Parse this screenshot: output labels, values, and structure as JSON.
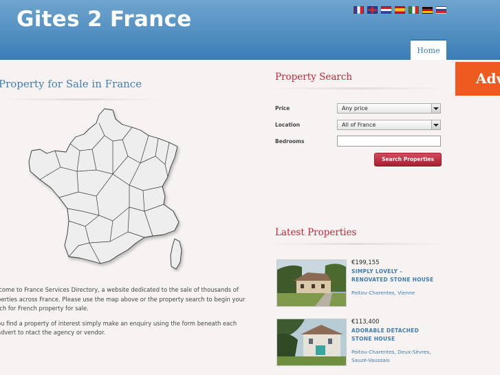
{
  "header": {
    "logo": "Gites 2 France",
    "flags": [
      "fr",
      "gb",
      "nl",
      "es",
      "it",
      "de",
      "ru"
    ],
    "nav_home": "Home"
  },
  "advert_tab": "Adv",
  "main": {
    "title": "Property for Sale in France",
    "intro": [
      "lcome to France Services Directory, a website dedicated to the sale of thousands of perties across France. Please use the map above or the property search to begin your rch for French property for sale.",
      "ou find a property of interest simply make an enquiry using the form beneath each advert to ntact the agency or vendor."
    ]
  },
  "search": {
    "title": "Property Search",
    "price_label": "Price",
    "price_value": "Any price",
    "location_label": "Location",
    "location_value": "All of France",
    "bedrooms_label": "Bedrooms",
    "bedrooms_value": "",
    "button": "Search Properties"
  },
  "latest": {
    "title": "Latest Properties",
    "items": [
      {
        "price": "€199,155",
        "title": "SIMPLY LOVELY – RENOVATED STONE HOUSE",
        "location": "Poitou-Charentes, Vienne"
      },
      {
        "price": "€113,400",
        "title": "ADORABLE DETACHED STONE HOUSE",
        "location": "Poitou-Charentes, Deux-Sèvres, Sauzé-Vaussais"
      }
    ]
  },
  "colors": {
    "header_blue": "#3a7db5",
    "accent_red": "#c8243a",
    "advert_orange": "#ee5a1f",
    "link_blue": "#3d7cb3"
  }
}
